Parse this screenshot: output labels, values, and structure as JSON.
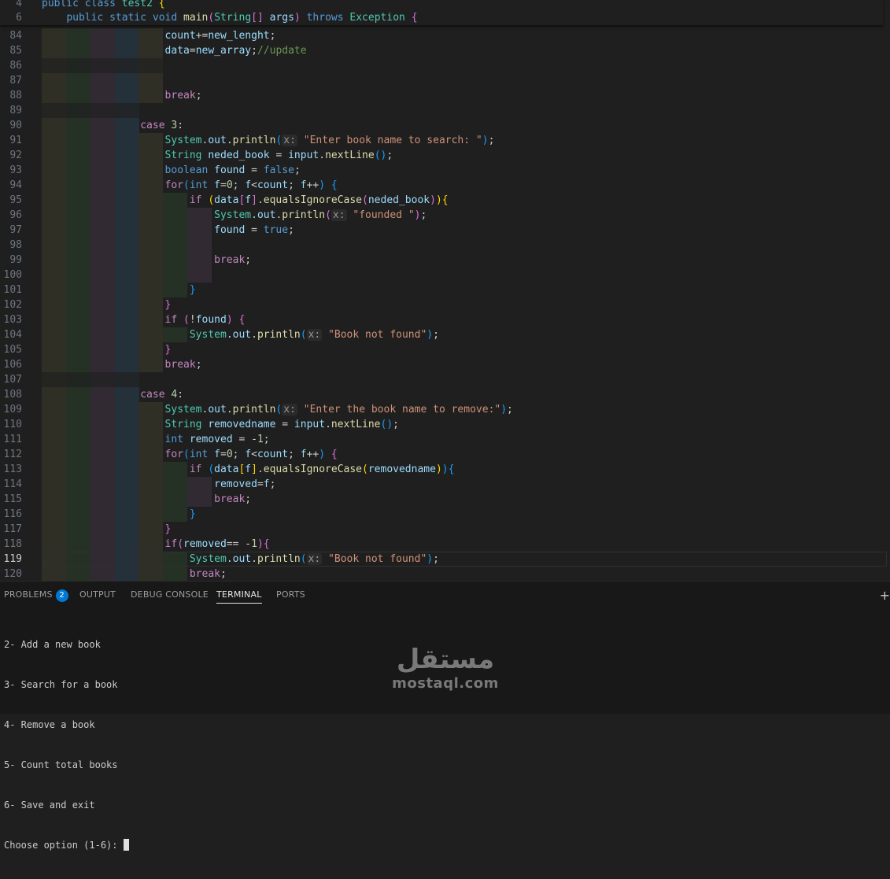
{
  "sticky": [
    {
      "n": "4",
      "t": [
        [
          "kw",
          "public"
        ],
        [
          "pl",
          " "
        ],
        [
          "kw",
          "class"
        ],
        [
          "pl",
          " "
        ],
        [
          "ty",
          "test2"
        ],
        [
          "pl",
          " "
        ],
        [
          "b-y",
          "{"
        ]
      ]
    },
    {
      "n": "6",
      "t": [
        [
          "pl",
          "    "
        ],
        [
          "kw",
          "public"
        ],
        [
          "pl",
          " "
        ],
        [
          "kw",
          "static"
        ],
        [
          "pl",
          " "
        ],
        [
          "kw",
          "void"
        ],
        [
          "pl",
          " "
        ],
        [
          "fn",
          "main"
        ],
        [
          "b-p",
          "("
        ],
        [
          "ty",
          "String"
        ],
        [
          "b-p",
          "[]"
        ],
        [
          "pl",
          " "
        ],
        [
          "var",
          "args"
        ],
        [
          "b-p",
          ")"
        ],
        [
          "pl",
          " "
        ],
        [
          "kw",
          "throws"
        ],
        [
          "pl",
          " "
        ],
        [
          "ty",
          "Exception"
        ],
        [
          "pl",
          " "
        ],
        [
          "b-p",
          "{"
        ]
      ]
    }
  ],
  "lines": [
    {
      "n": "84",
      "t": [
        [
          "var",
          "count"
        ],
        [
          "pl",
          "+="
        ],
        [
          "var",
          "new_lenght"
        ],
        [
          "pl",
          ";"
        ]
      ]
    },
    {
      "n": "85",
      "t": [
        [
          "var",
          "data"
        ],
        [
          "pl",
          "="
        ],
        [
          "var",
          "new_array"
        ],
        [
          "pl",
          ";"
        ],
        [
          "cmt",
          "//update"
        ]
      ]
    },
    {
      "n": "86",
      "t": []
    },
    {
      "n": "87",
      "t": []
    },
    {
      "n": "88",
      "t": [
        [
          "ctl",
          "break"
        ],
        [
          "pl",
          ";"
        ]
      ]
    },
    {
      "n": "89",
      "t": []
    },
    {
      "n": "90",
      "t": [
        [
          "ctl",
          "case"
        ],
        [
          "pl",
          " "
        ],
        [
          "num",
          "3"
        ],
        [
          "pl",
          ":"
        ]
      ]
    },
    {
      "n": "91",
      "t": [
        [
          "ty",
          "System"
        ],
        [
          "pl",
          "."
        ],
        [
          "var",
          "out"
        ],
        [
          "pl",
          "."
        ],
        [
          "fn",
          "println"
        ],
        [
          "b-b",
          "("
        ],
        [
          "hint",
          "x:"
        ],
        [
          "pl",
          " "
        ],
        [
          "str",
          "\"Enter book name to search: \""
        ],
        [
          "b-b",
          ")"
        ],
        [
          "pl",
          ";"
        ]
      ]
    },
    {
      "n": "92",
      "t": [
        [
          "ty",
          "String"
        ],
        [
          "pl",
          " "
        ],
        [
          "var",
          "neded_book"
        ],
        [
          "pl",
          " = "
        ],
        [
          "var",
          "input"
        ],
        [
          "pl",
          "."
        ],
        [
          "fn",
          "nextLine"
        ],
        [
          "b-b",
          "()"
        ],
        [
          "pl",
          ";"
        ]
      ]
    },
    {
      "n": "93",
      "t": [
        [
          "kw",
          "boolean"
        ],
        [
          "pl",
          " "
        ],
        [
          "var",
          "found"
        ],
        [
          "pl",
          " = "
        ],
        [
          "kw",
          "false"
        ],
        [
          "pl",
          ";"
        ]
      ]
    },
    {
      "n": "94",
      "t": [
        [
          "ctl",
          "for"
        ],
        [
          "b-b",
          "("
        ],
        [
          "kw",
          "int"
        ],
        [
          "pl",
          " "
        ],
        [
          "var",
          "f"
        ],
        [
          "pl",
          "="
        ],
        [
          "num",
          "0"
        ],
        [
          "pl",
          "; "
        ],
        [
          "var",
          "f"
        ],
        [
          "pl",
          "<"
        ],
        [
          "var",
          "count"
        ],
        [
          "pl",
          "; "
        ],
        [
          "var",
          "f"
        ],
        [
          "pl",
          "++"
        ],
        [
          "b-b",
          ")"
        ],
        [
          "pl",
          " "
        ],
        [
          "b-b",
          "{"
        ]
      ]
    },
    {
      "n": "95",
      "t": [
        [
          "ctl",
          "if"
        ],
        [
          "pl",
          " "
        ],
        [
          "b-y",
          "("
        ],
        [
          "var",
          "data"
        ],
        [
          "b-p",
          "["
        ],
        [
          "var",
          "f"
        ],
        [
          "b-p",
          "]"
        ],
        [
          "pl",
          "."
        ],
        [
          "fn",
          "equalsIgnoreCase"
        ],
        [
          "b-p",
          "("
        ],
        [
          "var",
          "neded_book"
        ],
        [
          "b-p",
          ")"
        ],
        [
          "b-y",
          ")"
        ],
        [
          "b-y",
          "{"
        ]
      ]
    },
    {
      "n": "96",
      "t": [
        [
          "ty",
          "System"
        ],
        [
          "pl",
          "."
        ],
        [
          "var",
          "out"
        ],
        [
          "pl",
          "."
        ],
        [
          "fn",
          "println"
        ],
        [
          "b-p",
          "("
        ],
        [
          "hint",
          "x:"
        ],
        [
          "pl",
          " "
        ],
        [
          "str",
          "\"founded \""
        ],
        [
          "b-p",
          ")"
        ],
        [
          "pl",
          ";"
        ]
      ]
    },
    {
      "n": "97",
      "t": [
        [
          "var",
          "found"
        ],
        [
          "pl",
          " = "
        ],
        [
          "kw",
          "true"
        ],
        [
          "pl",
          ";"
        ]
      ]
    },
    {
      "n": "98",
      "t": []
    },
    {
      "n": "99",
      "t": [
        [
          "ctl",
          "break"
        ],
        [
          "pl",
          ";"
        ]
      ]
    },
    {
      "n": "100",
      "t": []
    },
    {
      "n": "101",
      "t": [
        [
          "b-b",
          "}"
        ]
      ]
    },
    {
      "n": "102",
      "t": [
        [
          "b-p",
          "}"
        ]
      ]
    },
    {
      "n": "103",
      "t": [
        [
          "ctl",
          "if"
        ],
        [
          "pl",
          " "
        ],
        [
          "b-p",
          "("
        ],
        [
          "pl",
          "!"
        ],
        [
          "var",
          "found"
        ],
        [
          "b-p",
          ")"
        ],
        [
          "pl",
          " "
        ],
        [
          "b-p",
          "{"
        ]
      ]
    },
    {
      "n": "104",
      "t": [
        [
          "ty",
          "System"
        ],
        [
          "pl",
          "."
        ],
        [
          "var",
          "out"
        ],
        [
          "pl",
          "."
        ],
        [
          "fn",
          "println"
        ],
        [
          "b-b",
          "("
        ],
        [
          "hint",
          "x:"
        ],
        [
          "pl",
          " "
        ],
        [
          "str",
          "\"Book not found\""
        ],
        [
          "b-b",
          ")"
        ],
        [
          "pl",
          ";"
        ]
      ]
    },
    {
      "n": "105",
      "t": [
        [
          "b-p",
          "}"
        ]
      ]
    },
    {
      "n": "106",
      "t": [
        [
          "ctl",
          "break"
        ],
        [
          "pl",
          ";"
        ]
      ]
    },
    {
      "n": "107",
      "t": []
    },
    {
      "n": "108",
      "t": [
        [
          "ctl",
          "case"
        ],
        [
          "pl",
          " "
        ],
        [
          "num",
          "4"
        ],
        [
          "pl",
          ":"
        ]
      ]
    },
    {
      "n": "109",
      "t": [
        [
          "ty",
          "System"
        ],
        [
          "pl",
          "."
        ],
        [
          "var",
          "out"
        ],
        [
          "pl",
          "."
        ],
        [
          "fn",
          "println"
        ],
        [
          "b-b",
          "("
        ],
        [
          "hint",
          "x:"
        ],
        [
          "pl",
          " "
        ],
        [
          "str",
          "\"Enter the book name to remove:\""
        ],
        [
          "b-b",
          ")"
        ],
        [
          "pl",
          ";"
        ]
      ]
    },
    {
      "n": "110",
      "t": [
        [
          "ty",
          "String"
        ],
        [
          "pl",
          " "
        ],
        [
          "var",
          "removedname"
        ],
        [
          "pl",
          " = "
        ],
        [
          "var",
          "input"
        ],
        [
          "pl",
          "."
        ],
        [
          "fn",
          "nextLine"
        ],
        [
          "b-b",
          "()"
        ],
        [
          "pl",
          ";"
        ]
      ]
    },
    {
      "n": "111",
      "t": [
        [
          "kw",
          "int"
        ],
        [
          "pl",
          " "
        ],
        [
          "var",
          "removed"
        ],
        [
          "pl",
          " = -"
        ],
        [
          "num",
          "1"
        ],
        [
          "pl",
          ";"
        ]
      ]
    },
    {
      "n": "112",
      "t": [
        [
          "ctl",
          "for"
        ],
        [
          "b-b",
          "("
        ],
        [
          "kw",
          "int"
        ],
        [
          "pl",
          " "
        ],
        [
          "var",
          "f"
        ],
        [
          "pl",
          "="
        ],
        [
          "num",
          "0"
        ],
        [
          "pl",
          "; "
        ],
        [
          "var",
          "f"
        ],
        [
          "pl",
          "<"
        ],
        [
          "var",
          "count"
        ],
        [
          "pl",
          "; "
        ],
        [
          "var",
          "f"
        ],
        [
          "pl",
          "++"
        ],
        [
          "b-b",
          ")"
        ],
        [
          "pl",
          " "
        ],
        [
          "b-p",
          "{"
        ]
      ]
    },
    {
      "n": "113",
      "t": [
        [
          "ctl",
          "if"
        ],
        [
          "pl",
          " "
        ],
        [
          "b-b",
          "("
        ],
        [
          "var",
          "data"
        ],
        [
          "b-y",
          "["
        ],
        [
          "var",
          "f"
        ],
        [
          "b-y",
          "]"
        ],
        [
          "pl",
          "."
        ],
        [
          "fn",
          "equalsIgnoreCase"
        ],
        [
          "b-y",
          "("
        ],
        [
          "var",
          "removedname"
        ],
        [
          "b-y",
          ")"
        ],
        [
          "b-b",
          ")"
        ],
        [
          "b-b",
          "{"
        ]
      ]
    },
    {
      "n": "114",
      "t": [
        [
          "var",
          "removed"
        ],
        [
          "pl",
          "="
        ],
        [
          "var",
          "f"
        ],
        [
          "pl",
          ";"
        ]
      ]
    },
    {
      "n": "115",
      "t": [
        [
          "ctl",
          "break"
        ],
        [
          "pl",
          ";"
        ]
      ]
    },
    {
      "n": "116",
      "t": [
        [
          "b-b",
          "}"
        ]
      ]
    },
    {
      "n": "117",
      "t": [
        [
          "b-p",
          "}"
        ]
      ]
    },
    {
      "n": "118",
      "t": [
        [
          "ctl",
          "if"
        ],
        [
          "b-p",
          "("
        ],
        [
          "var",
          "removed"
        ],
        [
          "pl",
          "== -"
        ],
        [
          "num",
          "1"
        ],
        [
          "b-p",
          ")"
        ],
        [
          "b-p",
          "{"
        ]
      ]
    },
    {
      "n": "119",
      "t": [
        [
          "ty",
          "System"
        ],
        [
          "pl",
          "."
        ],
        [
          "var",
          "out"
        ],
        [
          "pl",
          "."
        ],
        [
          "fn",
          "println"
        ],
        [
          "b-b",
          "("
        ],
        [
          "hint",
          "x:"
        ],
        [
          "pl",
          " "
        ],
        [
          "str",
          "\"Book not found\""
        ],
        [
          "b-b",
          ")"
        ],
        [
          "pl",
          ";"
        ]
      ]
    },
    {
      "n": "120",
      "t": [
        [
          "ctl",
          "break"
        ],
        [
          "pl",
          ";"
        ]
      ]
    }
  ],
  "panel": {
    "tabs": {
      "problems": "PROBLEMS",
      "problems_count": "2",
      "output": "OUTPUT",
      "debug": "DEBUG CONSOLE",
      "terminal": "TERMINAL",
      "ports": "PORTS"
    },
    "add_icon": "+",
    "terminal_lines": [
      "2- Add a new book",
      "3- Search for a book",
      "4- Remove a book",
      "5- Count total books",
      "6- Save and exit",
      "Choose option (1-6): "
    ]
  },
  "watermark": {
    "arabic": "مستقل",
    "latin": "mostaql.com"
  },
  "colors": {
    "editor_bg": "#1f1f1f",
    "panel_bg": "#181818",
    "badge": "#0078d4"
  }
}
